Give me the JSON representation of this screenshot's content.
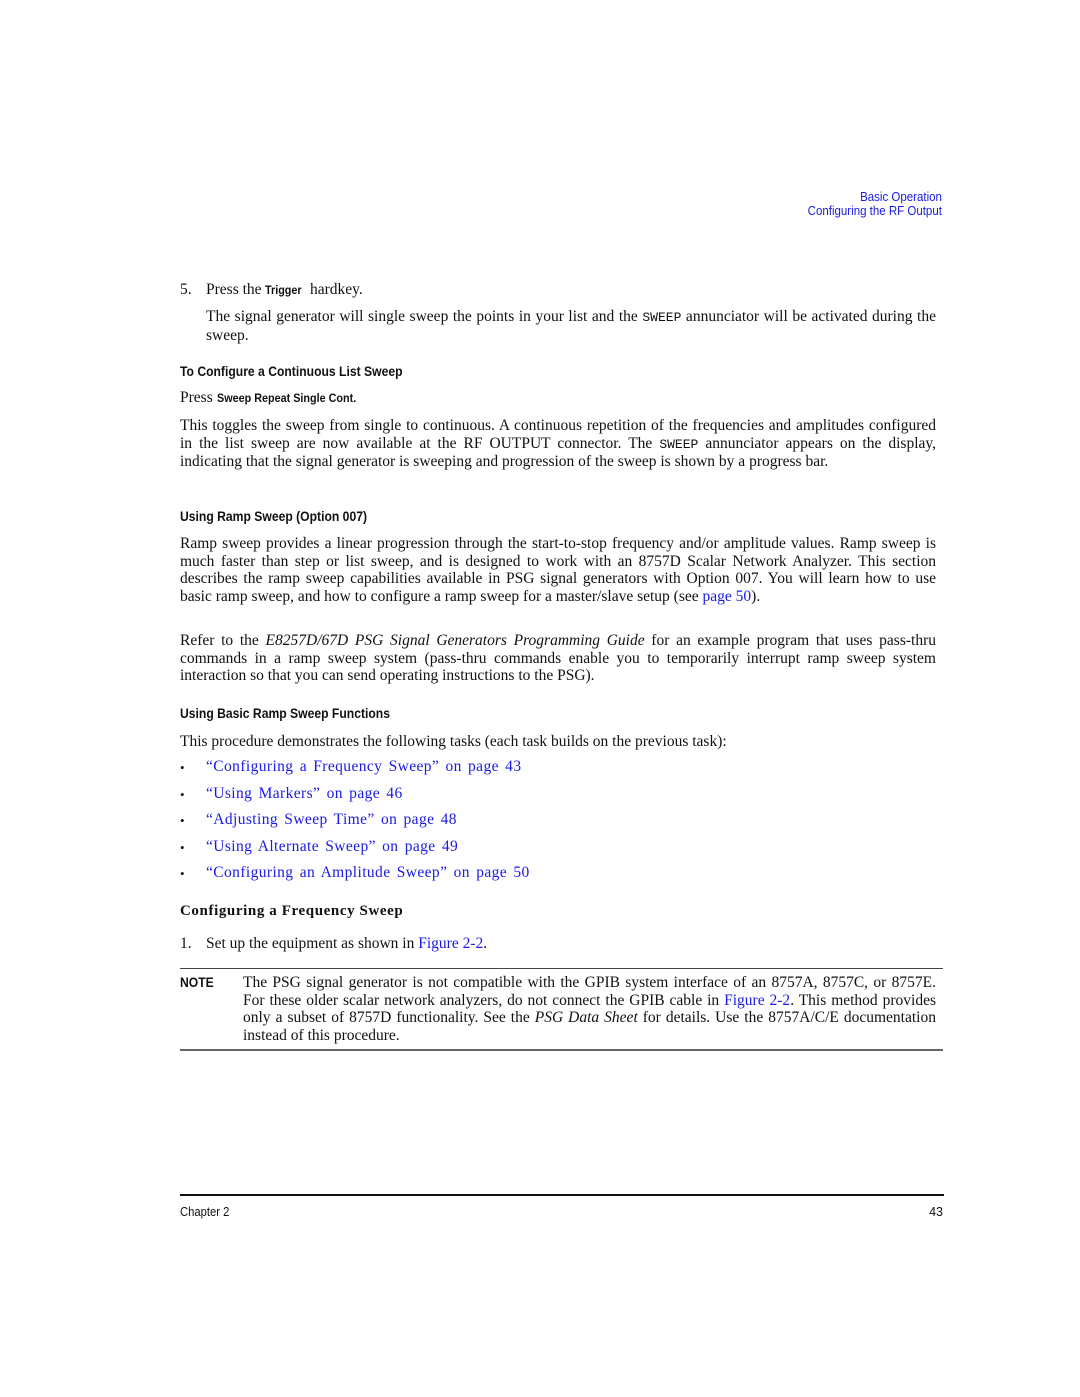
{
  "running_head": {
    "section": "Basic Operation",
    "subsection": "Configuring the RF Output"
  },
  "step5": {
    "number": "5.",
    "pre": "Press the ",
    "key": "Trigger",
    "post": " hardkey.",
    "detail_pre": "The signal generator will single sweep the points in your list and the ",
    "detail_code": "SWEEP",
    "detail_post": " annunciator will be activated during the sweep."
  },
  "continuous": {
    "heading": "To Configure a Continuous List Sweep",
    "press_label": "Press ",
    "press_keys": "Sweep Repeat Single Cont.",
    "body_pre": "This toggles the sweep from single to continuous. A continuous repetition of the frequencies and amplitudes configured in the list sweep are now available at the RF OUTPUT connector. The ",
    "body_code": "SWEEP",
    "body_post": " annunciator appears on the display, indicating that the signal generator is sweeping and progression of the sweep is shown by a progress bar."
  },
  "ramp": {
    "heading": "Using Ramp Sweep (Option 007)",
    "p1_pre": "Ramp sweep provides a linear progression through the start-to-stop frequency and/or amplitude values. Ramp sweep is much faster than step or list sweep, and is designed to work with an 8757D Scalar Network Analyzer. This section describes the ramp sweep capabilities available in PSG signal generators with Option 007. You will learn how to use basic ramp sweep, and how to configure a ramp sweep for a master/slave setup (see ",
    "p1_link": "page 50",
    "p1_post": ").",
    "p2_pre": "Refer to the ",
    "p2_italic": "E8257D/67D PSG Signal Generators Programming Guide",
    "p2_post": " for an example program that uses pass-thru commands in a ramp sweep system (pass-thru commands enable you to temporarily interrupt ramp sweep system interaction so that you can send operating instructions to the PSG)."
  },
  "basic_ramp": {
    "heading": "Using Basic Ramp Sweep Functions",
    "intro": "This procedure demonstrates the following tasks (each task builds on the previous task):",
    "bullet_glyph": "•",
    "tasks": [
      {
        "label": "“Configuring a Frequency Sweep” on page 43"
      },
      {
        "label": "“Using Markers” on page 46"
      },
      {
        "label": "“Adjusting Sweep Time” on page 48"
      },
      {
        "label": "“Using Alternate Sweep” on page 49"
      },
      {
        "label": "“Configuring an Amplitude Sweep” on page 50"
      }
    ]
  },
  "freq_sweep": {
    "heading": "Configuring a Frequency Sweep",
    "step1_number": "1.",
    "step1_pre": "Set up the equipment as shown in ",
    "step1_link": "Figure 2-2",
    "step1_post": "."
  },
  "note": {
    "label": "NOTE",
    "text_pre": "The PSG signal generator is not compatible with the GPIB system interface of an 8757A, 8757C, or 8757E. For these older scalar network analyzers, do not connect the GPIB cable in ",
    "text_link": "Figure 2-2",
    "text_mid": ". This method provides only a subset of 8757D functionality. See the ",
    "text_italic": "PSG Data Sheet",
    "text_post": " for details. Use the 8757A/C/E documentation instead of this procedure."
  },
  "footer": {
    "chapter": "Chapter 2",
    "page_number": "43"
  },
  "colors": {
    "link": "#1a1ae6",
    "text": "#111111"
  }
}
